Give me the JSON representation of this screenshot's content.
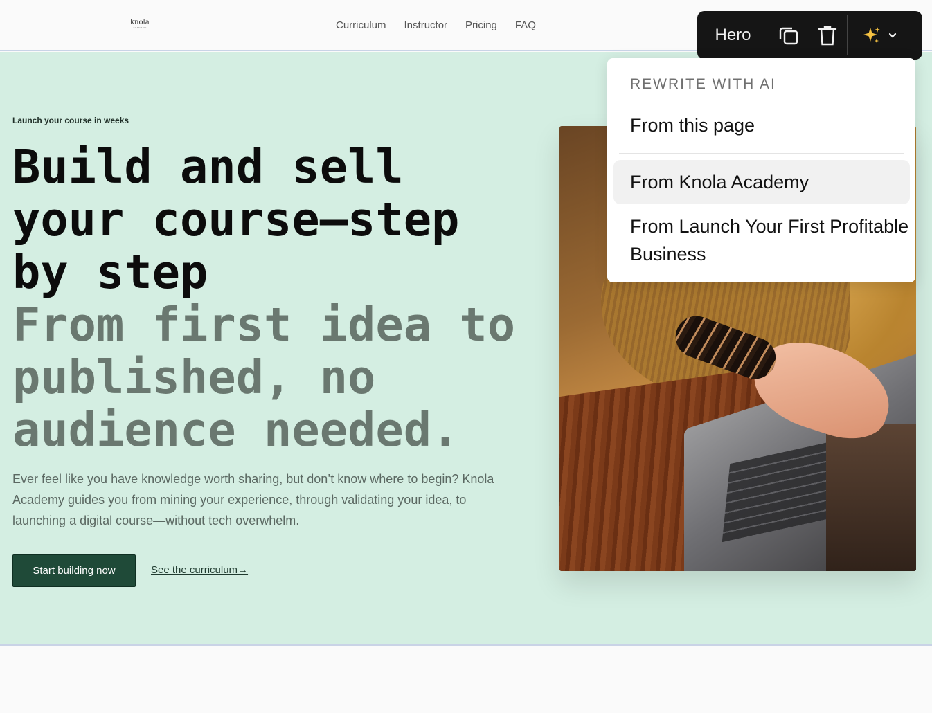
{
  "header": {
    "logo_text": "knola",
    "logo_sub": "ACADEMY",
    "nav": [
      "Curriculum",
      "Instructor",
      "Pricing",
      "FAQ"
    ]
  },
  "hero": {
    "eyebrow": "Launch your course in weeks",
    "headline": "Build and sell your course—step by step",
    "subheadline": "From first idea to published, no audience needed.",
    "lede": "Ever feel like you have knowledge worth sharing, but don’t know where to begin? Knola Academy guides you from mining your experience, through validating your idea, to launching a digital course—without tech overwhelm.",
    "primary_cta": "Start building now",
    "secondary_cta": "See the curriculum→"
  },
  "editor_toolbar": {
    "section_label": "Hero",
    "icons": [
      "duplicate-icon",
      "trash-icon",
      "sparkles-icon",
      "chevron-down-icon"
    ],
    "accent": "#f5c242"
  },
  "ai_menu": {
    "header": "REWRITE WITH AI",
    "items": [
      "From this page",
      "From Knola Academy",
      "From Launch Your First Profitable Business"
    ]
  },
  "colors": {
    "hero_bg": "#d4eee2",
    "primary_button": "#1f4a38",
    "toolbar_bg": "#151515"
  }
}
